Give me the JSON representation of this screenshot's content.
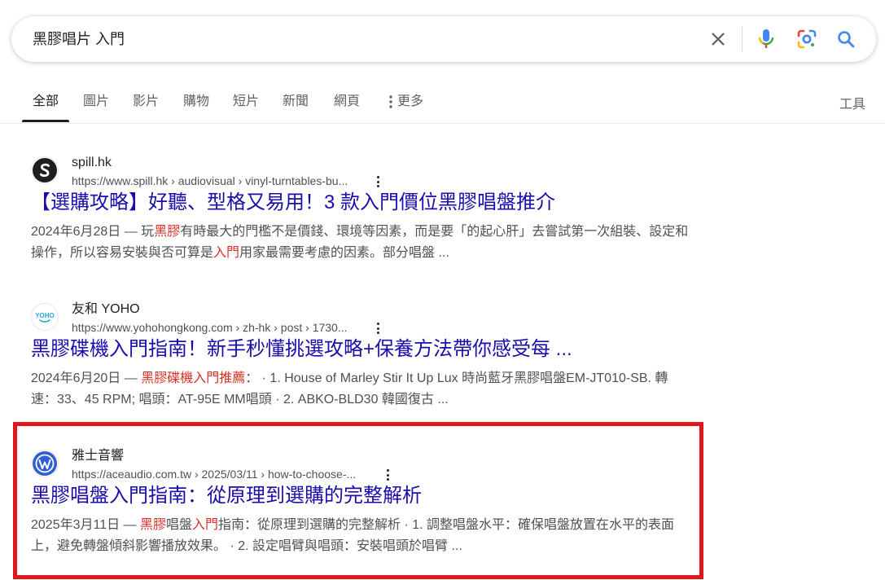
{
  "search": {
    "query": "黑膠唱片 入門"
  },
  "colors": {
    "link": "#1a0dab",
    "highlight": "#d93025",
    "annotation_box": "#e0161c"
  },
  "tabs": [
    {
      "label": "全部",
      "active": true
    },
    {
      "label": "圖片"
    },
    {
      "label": "影片"
    },
    {
      "label": "購物"
    },
    {
      "label": "短片"
    },
    {
      "label": "新聞"
    },
    {
      "label": "網頁"
    },
    {
      "label": "更多"
    }
  ],
  "tools_label": "工具",
  "results": [
    {
      "site_name": "spill.hk",
      "url": "https://www.spill.hk › audiovisual › vinyl-turntables-bu...",
      "title": "【選購攻略】好聽、型格又易用！3 款入門價位黑膠唱盤推介",
      "snippet": [
        {
          "t": "2024年6月28日 — 玩"
        },
        {
          "t": "黑膠",
          "hl": true
        },
        {
          "t": "有時最大的門檻不是價錢、環境等因素，而是要「的起心肝」去嘗試第一次組裝、設定和操作，所以容易安裝與否可算是"
        },
        {
          "t": "入門",
          "hl": true
        },
        {
          "t": "用家最需要考慮的因素。部分唱盤 ..."
        }
      ],
      "favicon_icon": "spill-logo-icon"
    },
    {
      "site_name": "友和 YOHO",
      "url": "https://www.yohohongkong.com › zh-hk › post › 1730...",
      "title": "黑膠碟機入門指南！新手秒懂挑選攻略+保養方法帶你感受每 ...",
      "snippet": [
        {
          "t": "2024年6月20日 — "
        },
        {
          "t": "黑膠碟機入門推薦",
          "hl": true
        },
        {
          "t": "： · 1. House of Marley Stir It Up Lux 時尚藍牙黑膠唱盤EM-JT010-SB. 轉速：33、45 RPM; 唱頭：AT-95E MM唱頭 · 2. ABKO-BLD30 韓國復古 ..."
        }
      ],
      "favicon_text": "YOHO",
      "favicon_icon": "yoho-logo-icon"
    },
    {
      "site_name": "雅士音響",
      "url": "https://aceaudio.com.tw › 2025/03/11 › how-to-choose-...",
      "title": "黑膠唱盤入門指南：從原理到選購的完整解析",
      "snippet": [
        {
          "t": "2025年3月11日 — "
        },
        {
          "t": "黑膠",
          "hl": true
        },
        {
          "t": "唱盤"
        },
        {
          "t": "入門",
          "hl": true
        },
        {
          "t": "指南：從原理到選購的完整解析 · 1. 調整唱盤水平：確保唱盤放置在水平的表面上，避免轉盤傾斜影響播放效果。 · 2. 設定唱臂與唱頭：安裝唱頭於唱臂 ..."
        }
      ],
      "favicon_icon": "wordpress-logo-icon"
    }
  ]
}
